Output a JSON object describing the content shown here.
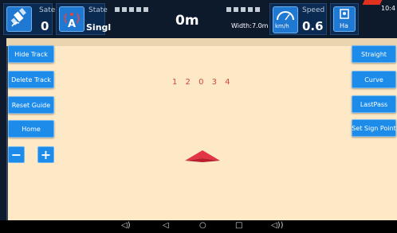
{
  "topbar": {
    "sate": {
      "label": "Sate",
      "value": "0",
      "icon": "satellite-icon"
    },
    "state": {
      "label": "State",
      "value": "Singl",
      "icon": "antenna-icon",
      "antenna_letter": "A"
    },
    "distance": "0m",
    "width": "Width:7.0m",
    "speed": {
      "label": "Speed",
      "unit": "km/h",
      "value": "0.6",
      "icon": "speedometer-icon"
    },
    "ha": {
      "label": "Ha",
      "icon": "area-icon"
    },
    "status_time": "10:4"
  },
  "left_buttons": {
    "hide_track": "Hide Track",
    "delete_track": "Delete Track",
    "reset_guide": "Reset Guide",
    "home": "Home",
    "zoom_out": "−",
    "zoom_in": "+"
  },
  "right_buttons": {
    "straight": "Straight",
    "curve": "Curve",
    "last_pass": "LastPass",
    "set_sign_point": "Set Sign Point"
  },
  "map": {
    "lane_numbers": "1 2 0 3 4",
    "tractor_color": "#d8253b"
  },
  "navbar": {
    "volume_down": "◁)",
    "back": "◁",
    "home": "○",
    "recents": "□",
    "volume_up": "◁))"
  },
  "colors": {
    "accent": "#1d8bea",
    "map_bg": "#fde9c6",
    "lane_text": "#d2453b"
  }
}
